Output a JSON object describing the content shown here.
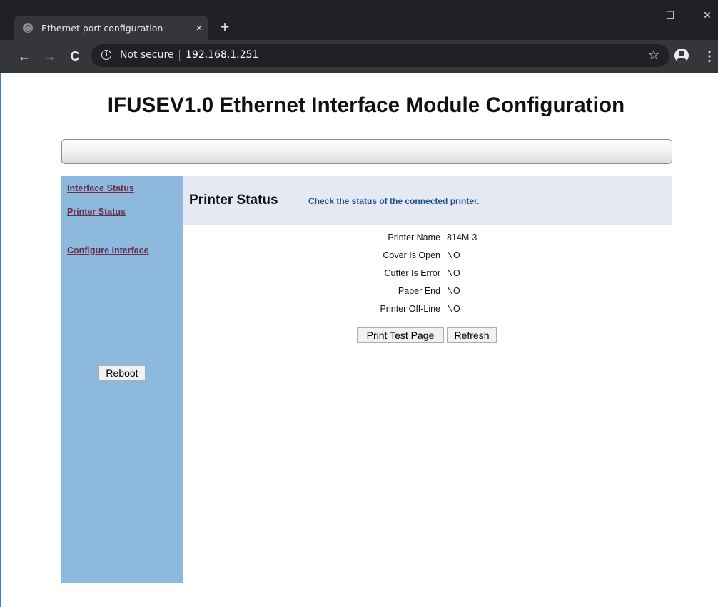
{
  "browser": {
    "tab_title": "Ethernet port configuration",
    "tab_close": "×",
    "new_tab": "+",
    "window_controls": {
      "minimize": "—",
      "maximize": "☐",
      "close": "✕"
    },
    "nav": {
      "back": "←",
      "forward": "→",
      "reload": "C"
    },
    "omnibox": {
      "info_icon": "i",
      "security_text": "Not secure",
      "url": "192.168.1.251",
      "star": "☆"
    },
    "menu": "⋮"
  },
  "page": {
    "title": "IFUSEV1.0 Ethernet Interface Module Configuration"
  },
  "sidebar": {
    "links": [
      {
        "label": "Interface Status"
      },
      {
        "label": "Printer Status"
      },
      {
        "label": "Configure Interface"
      }
    ],
    "reboot_label": "Reboot"
  },
  "main": {
    "section_title": "Printer Status",
    "section_desc": "Check the status of the connected printer.",
    "status_rows": [
      {
        "label": "Printer Name",
        "value": "814M-3"
      },
      {
        "label": "Cover Is Open",
        "value": "NO"
      },
      {
        "label": "Cutter Is Error",
        "value": "NO"
      },
      {
        "label": "Paper End",
        "value": "NO"
      },
      {
        "label": "Printer Off-Line",
        "value": "NO"
      }
    ],
    "buttons": {
      "print_test": "Print Test Page",
      "refresh": "Refresh"
    }
  }
}
